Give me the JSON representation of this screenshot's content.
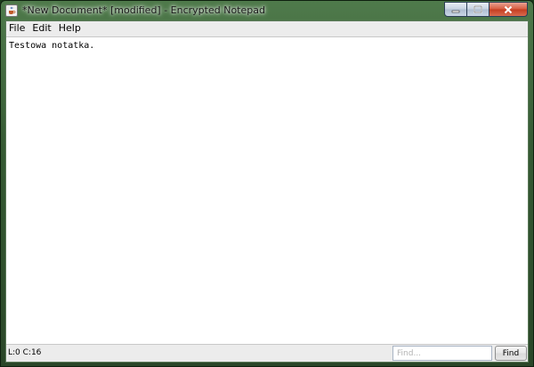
{
  "window": {
    "title": "*New Document* [modified] - Encrypted Notepad",
    "icon": "java-cup-icon",
    "controls": [
      "minimize-icon",
      "maximize-icon",
      "close-icon"
    ]
  },
  "menubar": {
    "items": [
      {
        "label": "File"
      },
      {
        "label": "Edit"
      },
      {
        "label": "Help"
      }
    ]
  },
  "editor": {
    "content": "Testowa notatka."
  },
  "statusbar": {
    "position": "L:0 C:16",
    "find": {
      "placeholder": "Find...",
      "value": "",
      "button_label": "Find"
    }
  },
  "colors": {
    "frame": "#355a33",
    "close_button": "#c43d20",
    "client_bg": "#ececec",
    "editor_bg": "#ffffff"
  }
}
